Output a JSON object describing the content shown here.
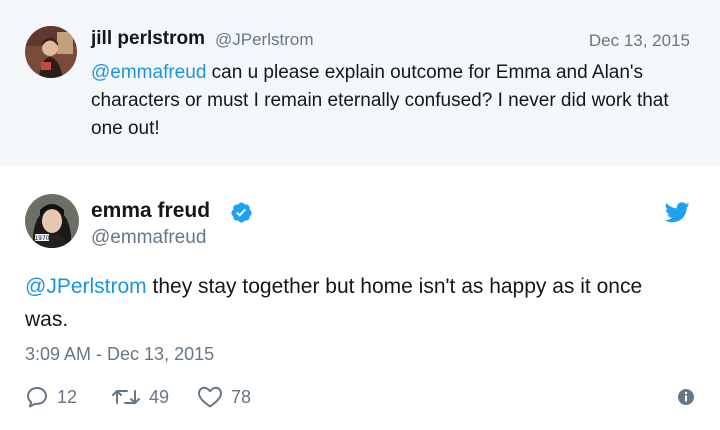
{
  "reply_context": {
    "display_name": "jill perlstrom",
    "handle": "@JPerlstrom",
    "date": "Dec 13, 2015",
    "mention": "@emmafreud",
    "text": " can u please explain outcome for Emma and Alan's characters or must I remain eternally confused? I never did work that one out!"
  },
  "main_tweet": {
    "display_name": "emma freud",
    "handle": "@emmafreud",
    "verified": true,
    "mention": "@JPerlstrom",
    "text": " they stay together but home isn't as happy as it once was.",
    "timestamp": "3:09 AM - Dec 13, 2015",
    "avatar_badge": "1970",
    "actions": {
      "replies": "12",
      "retweets": "49",
      "likes": "78"
    }
  },
  "colors": {
    "accent": "#1b95e0",
    "muted": "#657786",
    "text": "#14171a",
    "context_bg": "#f5f8fa",
    "twitter_blue": "#1da1f2"
  },
  "icons": {
    "verified": "verified-badge-icon",
    "brand": "twitter-bird-icon",
    "reply": "reply-icon",
    "retweet": "retweet-icon",
    "like": "heart-icon",
    "info": "info-icon"
  }
}
